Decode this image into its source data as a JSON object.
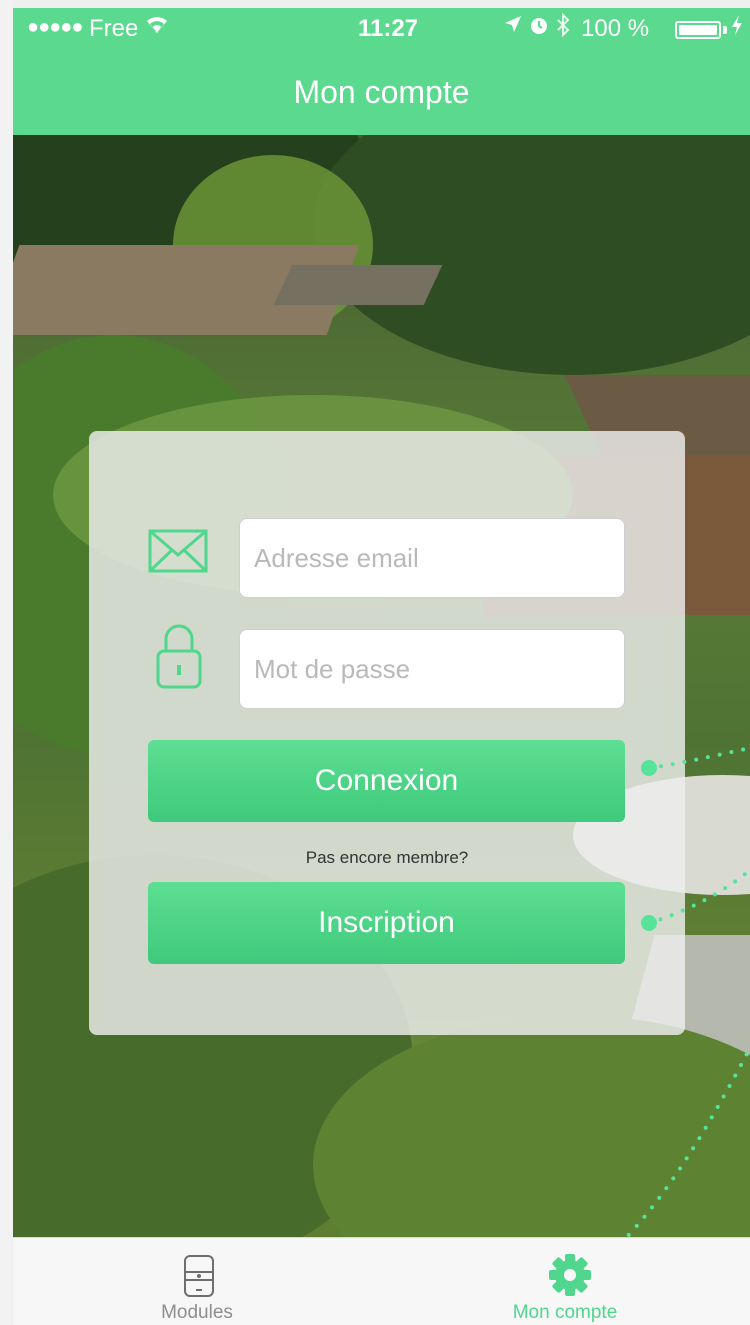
{
  "status_bar": {
    "signal": "●●●●●",
    "carrier": "Free",
    "time": "11:27",
    "battery_text": "100 %",
    "battery_level": 1.0
  },
  "nav": {
    "title": "Mon compte"
  },
  "login": {
    "email_placeholder": "Adresse email",
    "password_placeholder": "Mot de passe",
    "login_button": "Connexion",
    "signup_prompt": "Pas encore membre?",
    "signup_button": "Inscription"
  },
  "tabbar": {
    "tabs": [
      {
        "label": "Modules",
        "icon": "module-device-icon",
        "active": false
      },
      {
        "label": "Mon compte",
        "icon": "gear-icon",
        "active": true
      }
    ]
  },
  "colors": {
    "accent": "#5bd98f",
    "button": "#46cd80",
    "tab_active": "#50d68d",
    "tab_inactive": "#8e8e8e"
  }
}
